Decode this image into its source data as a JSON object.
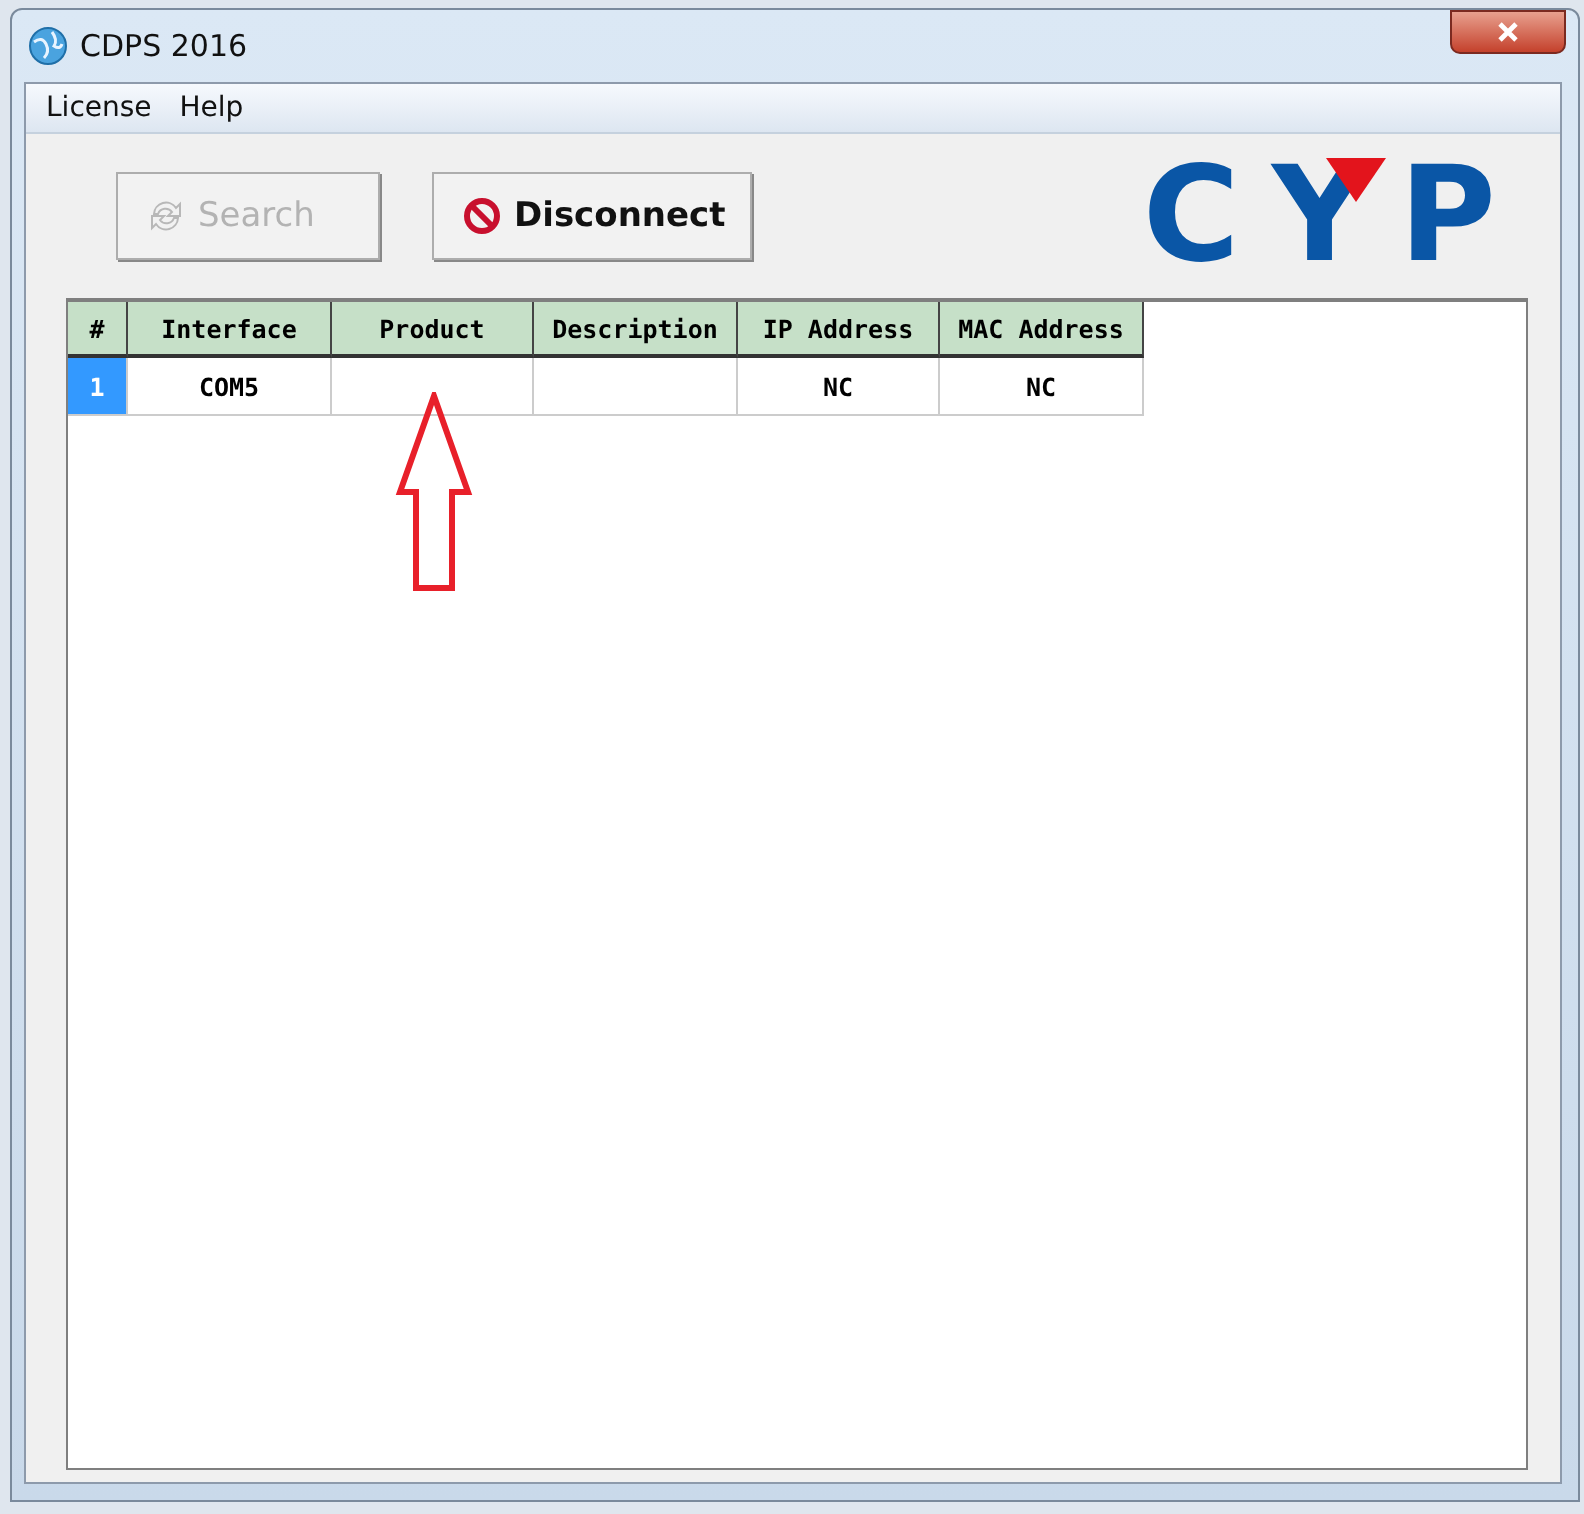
{
  "window": {
    "title": "CDPS 2016"
  },
  "menu": [
    "License",
    "Help"
  ],
  "buttons": [
    {
      "kind": "search",
      "label": "Search",
      "disabled": true
    },
    {
      "kind": "disconnect",
      "label": "Disconnect",
      "disabled": false
    }
  ],
  "logo": "CYP",
  "table": {
    "columns": [
      "#",
      "Interface",
      "Product",
      "Description",
      "IP Address",
      "MAC Address"
    ],
    "rows": [
      [
        "1",
        "COM5",
        "",
        "",
        "NC",
        "NC"
      ]
    ]
  }
}
